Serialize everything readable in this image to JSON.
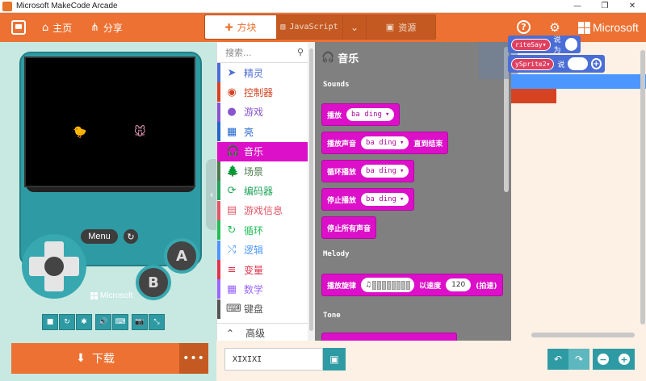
{
  "window": {
    "title": "Microsoft MakeCode Arcade",
    "controls": [
      "—",
      "❐",
      "✕"
    ]
  },
  "menubar": {
    "home_label": "主页",
    "share_label": "分享",
    "tabs": [
      {
        "label": "方块",
        "icon": "puzzle-icon"
      },
      {
        "label": "JavaScript",
        "icon": "code-icon"
      },
      {
        "label": "资源",
        "icon": "image-icon"
      }
    ],
    "dropdown_icon": "⌄",
    "help_icon": "?",
    "settings_icon": "⚙",
    "brand": "Microsoft"
  },
  "simulator": {
    "menu_label": "Menu",
    "a_label": "A",
    "b_label": "B",
    "brand": "Microsoft",
    "tools": [
      "■",
      "↻",
      "✱",
      "🔊",
      "⌨",
      "📷",
      "⤡"
    ]
  },
  "download": {
    "label": "下载",
    "more_label": "•••"
  },
  "toolbox": {
    "search_placeholder": "搜索...",
    "categories": [
      {
        "label": "精灵",
        "color": "#4b6ed6",
        "icon": "➤"
      },
      {
        "label": "控制器",
        "color": "#d54322",
        "icon": "◉"
      },
      {
        "label": "游戏",
        "color": "#8854d0",
        "icon": "●"
      },
      {
        "label": "亮",
        "color": "#2266cc",
        "icon": "▦"
      },
      {
        "label": "音乐",
        "color": "#dc10c8",
        "icon": "🎧"
      },
      {
        "label": "场景",
        "color": "#4b7b4b",
        "icon": "🌲"
      },
      {
        "label": "编码器",
        "color": "#21a35b",
        "icon": "⟳"
      },
      {
        "label": "游戏信息",
        "color": "#e05767",
        "icon": "▤"
      },
      {
        "label": "循环",
        "color": "#20bf55",
        "icon": "↻"
      },
      {
        "label": "逻辑",
        "color": "#4c97ff",
        "icon": "⤭"
      },
      {
        "label": "变量",
        "color": "#e0344d",
        "icon": "≡"
      },
      {
        "label": "数学",
        "color": "#9966ff",
        "icon": "▦"
      },
      {
        "label": "键盘",
        "color": "#555555",
        "icon": "⌨"
      }
    ],
    "advanced_label": "高级"
  },
  "flyout": {
    "title": "音乐",
    "sections": {
      "sounds": "Sounds",
      "melody": "Melody",
      "tone": "Tone"
    },
    "blocks": [
      {
        "prefix": "播放",
        "dropdown": "ba ding"
      },
      {
        "prefix": "播放声音",
        "dropdown": "ba ding",
        "suffix": "直到结束"
      },
      {
        "prefix": "循环播放",
        "dropdown": "ba ding"
      },
      {
        "prefix": "停止播放",
        "dropdown": "ba ding"
      },
      {
        "prefix": "停止所有声音"
      }
    ],
    "melody_block": {
      "prefix": "播放旋律",
      "mid": "以速度",
      "tempo": "120",
      "suffix": "(拍速)"
    }
  },
  "workspace": {
    "block1_var": "riteSay",
    "block1_tail": "说为",
    "block2_var": "ySprite2",
    "block2_tail": "说"
  },
  "bottombar": {
    "project_name": "XIXIXI"
  }
}
